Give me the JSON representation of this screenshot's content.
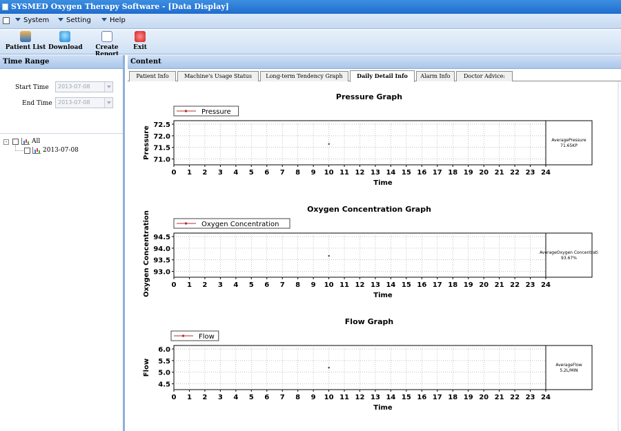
{
  "window": {
    "title": "SYSMED Oxygen Therapy Software - [Data Display]"
  },
  "menu": {
    "items": [
      "System",
      "Setting",
      "Help"
    ]
  },
  "toolbar": {
    "buttons": [
      "Patient List",
      "Download",
      "Create Report",
      "Exit"
    ]
  },
  "left_panel": {
    "header": "Time Range",
    "start_label": "Start Time",
    "start_value": "2013-07-08",
    "end_label": "End Time",
    "end_value": "2013-07-08",
    "tree": {
      "root": "All",
      "child": "2013-07-08",
      "root_expander": "-"
    }
  },
  "content": {
    "header": "Content",
    "tabs": [
      "Patient Info",
      "Machine's Usage Status",
      "Long-term Tendency Graph",
      "Daily Detail Info",
      "Alarm Info",
      "Doctor Advice:"
    ],
    "active_tab": 3
  },
  "colors": {
    "title_bar": "#2f7bd8",
    "legend_marker": "#b03030",
    "point": "#444444",
    "grid": "#9a9a9a"
  },
  "chart_data": [
    {
      "type": "scatter",
      "title": "Pressure Graph",
      "xlabel": "Time",
      "ylabel": "Pressure",
      "xlim": [
        0,
        24
      ],
      "ylim": [
        70.75,
        72.65
      ],
      "x_ticks": [
        0,
        1,
        2,
        3,
        4,
        5,
        6,
        7,
        8,
        9,
        10,
        11,
        12,
        13,
        14,
        15,
        16,
        17,
        18,
        19,
        20,
        21,
        22,
        23,
        24
      ],
      "y_ticks": [
        "71.0",
        "71.5",
        "72.0",
        "72.5"
      ],
      "y_tick_values": [
        71.0,
        71.5,
        72.0,
        72.5
      ],
      "legend": "Pressure",
      "points": [
        {
          "x": 10,
          "y": 71.65
        }
      ],
      "average_label": "AveragePressure",
      "average_value": "71.65KP",
      "grid": true
    },
    {
      "type": "scatter",
      "title": "Oxygen Concentration Graph",
      "xlabel": "Time",
      "ylabel": "Oxygen Concentration",
      "xlim": [
        0,
        24
      ],
      "ylim": [
        92.75,
        94.65
      ],
      "x_ticks": [
        0,
        1,
        2,
        3,
        4,
        5,
        6,
        7,
        8,
        9,
        10,
        11,
        12,
        13,
        14,
        15,
        16,
        17,
        18,
        19,
        20,
        21,
        22,
        23,
        24
      ],
      "y_ticks": [
        "93.0",
        "93.5",
        "94.0",
        "94.5"
      ],
      "y_tick_values": [
        93.0,
        93.5,
        94.0,
        94.5
      ],
      "legend": "Oxygen Concentration",
      "points": [
        {
          "x": 10,
          "y": 93.67
        }
      ],
      "average_label": "AverageOxygen Concentrati",
      "average_value": "93.67%",
      "grid": true
    },
    {
      "type": "scatter",
      "title": "Flow Graph",
      "xlabel": "Time",
      "ylabel": "Flow",
      "xlim": [
        0,
        24
      ],
      "ylim": [
        4.25,
        6.15
      ],
      "x_ticks": [
        0,
        1,
        2,
        3,
        4,
        5,
        6,
        7,
        8,
        9,
        10,
        11,
        12,
        13,
        14,
        15,
        16,
        17,
        18,
        19,
        20,
        21,
        22,
        23,
        24
      ],
      "y_ticks": [
        "4.5",
        "5.0",
        "5.5",
        "6.0"
      ],
      "y_tick_values": [
        4.5,
        5.0,
        5.5,
        6.0
      ],
      "legend": "Flow",
      "points": [
        {
          "x": 10,
          "y": 5.2
        }
      ],
      "average_label": "AverageFlow",
      "average_value": "5.2L/MIN",
      "grid": true
    }
  ]
}
